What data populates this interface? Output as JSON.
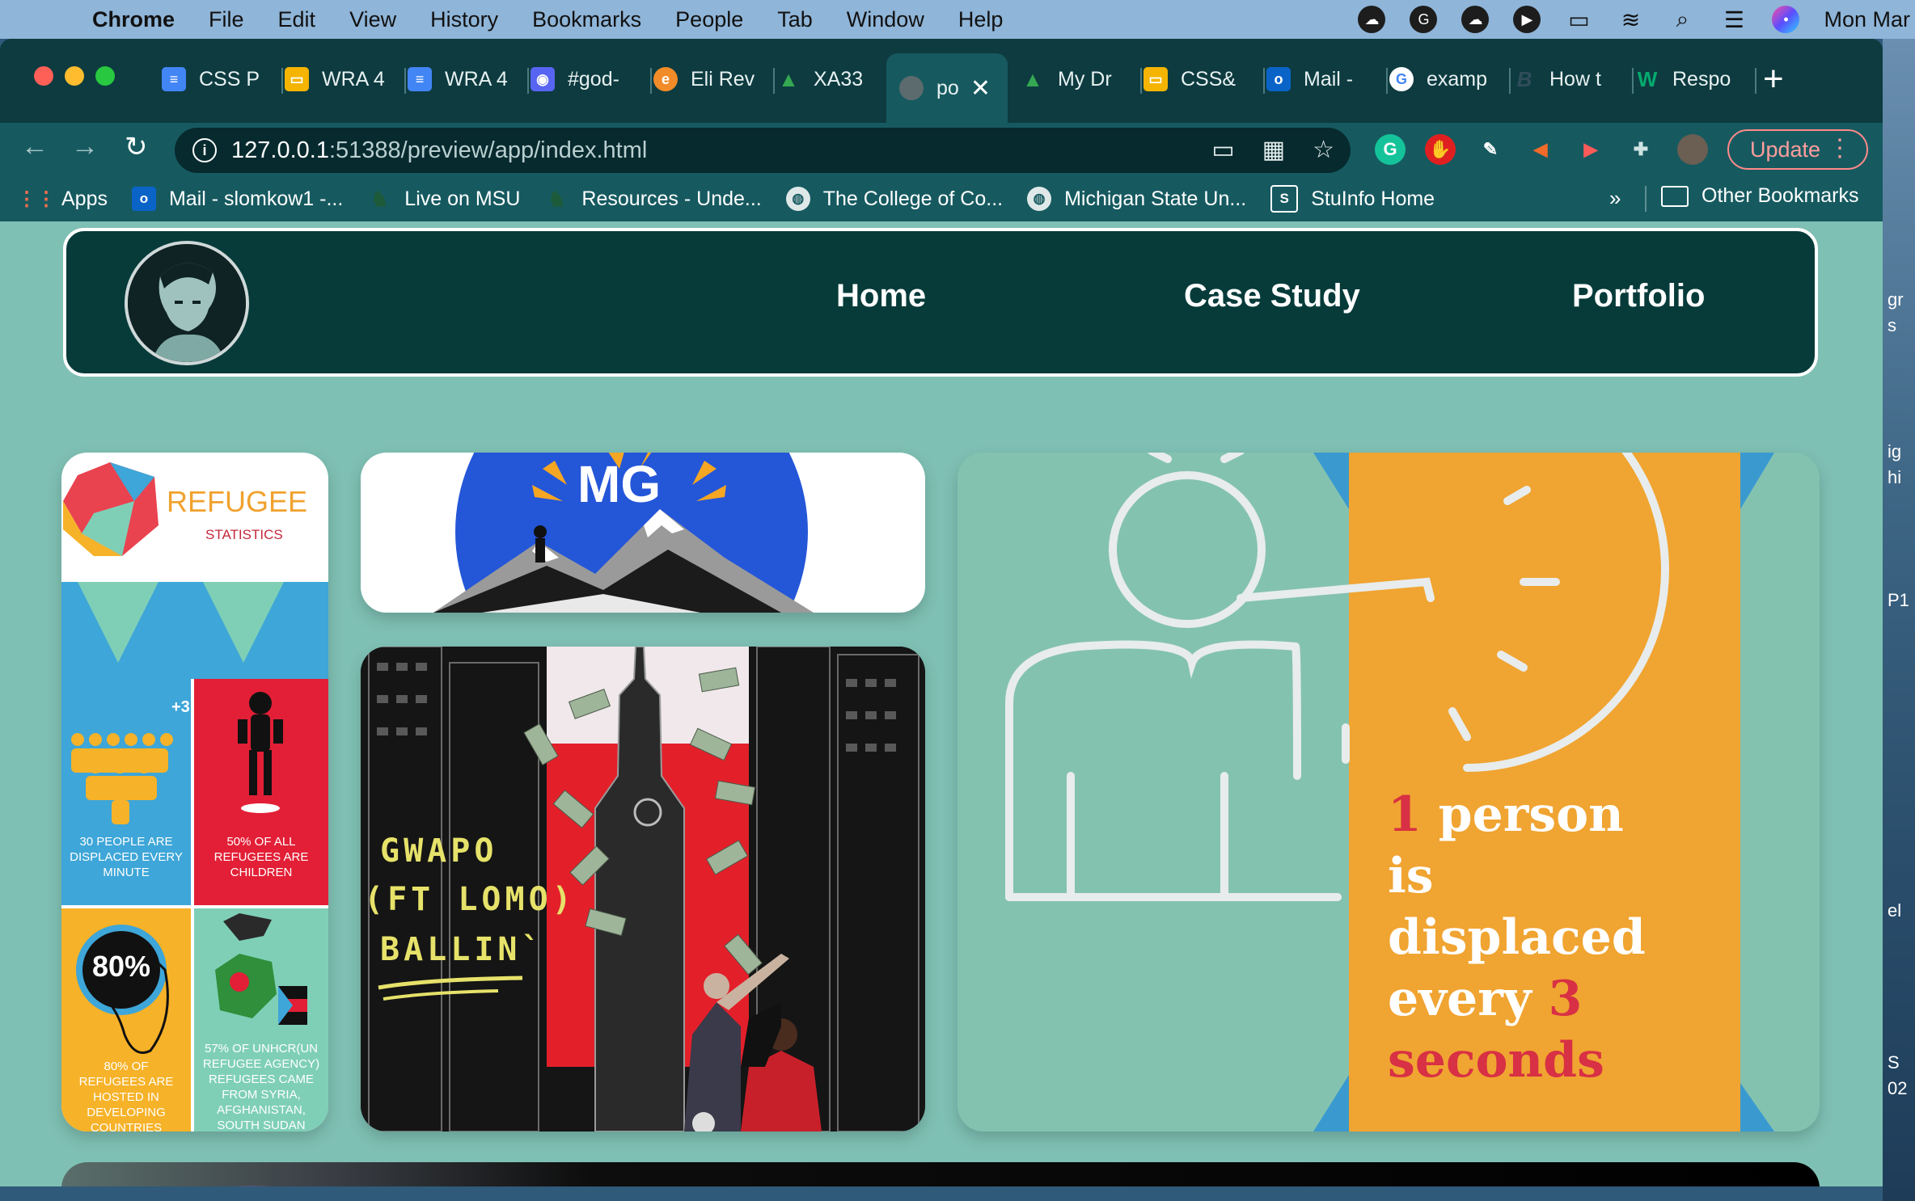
{
  "menubar": {
    "app": "Chrome",
    "items": [
      "File",
      "Edit",
      "View",
      "History",
      "Bookmarks",
      "People",
      "Tab",
      "Window",
      "Help"
    ],
    "clock": "Mon Mar"
  },
  "tabs": [
    {
      "label": "CSS P",
      "icon": "google-docs-icon",
      "color": "#4285f4"
    },
    {
      "label": "WRA 4",
      "icon": "google-slides-icon",
      "color": "#f4b400"
    },
    {
      "label": "WRA 4",
      "icon": "google-docs-icon",
      "color": "#4285f4"
    },
    {
      "label": "#god-",
      "icon": "discord-icon",
      "color": "#5865f2"
    },
    {
      "label": "Eli Rev",
      "icon": "eli-review-icon",
      "color": "#f28c28"
    },
    {
      "label": "XA33",
      "icon": "google-drive-icon",
      "color": "#34a853"
    },
    {
      "label": "po",
      "icon": "globe-icon",
      "color": "#6b7a7c",
      "active": true
    },
    {
      "label": "My Dr",
      "icon": "google-drive-icon",
      "color": "#34a853"
    },
    {
      "label": "CSS&",
      "icon": "google-slides-icon",
      "color": "#f4b400"
    },
    {
      "label": "Mail -",
      "icon": "outlook-icon",
      "color": "#0a64c8"
    },
    {
      "label": "examp",
      "icon": "google-icon",
      "color": "#ffffff"
    },
    {
      "label": "How t",
      "icon": "bootstrap-icon",
      "color": "#2f3d4a"
    },
    {
      "label": "Respo",
      "icon": "w3schools-icon",
      "color": "#04aa6d"
    }
  ],
  "toolbar": {
    "url_host": "127.0.0.1",
    "url_path": ":51388/preview/app/index.html",
    "update_label": "Update"
  },
  "bookmarks": {
    "items": [
      {
        "label": "Apps",
        "icon": "apps-grid-icon"
      },
      {
        "label": "Mail - slomkow1 -...",
        "icon": "outlook-icon"
      },
      {
        "label": "Live on MSU",
        "icon": "spartan-helmet-icon"
      },
      {
        "label": "Resources - Unde...",
        "icon": "spartan-helmet-icon"
      },
      {
        "label": "The College of Co...",
        "icon": "globe-icon"
      },
      {
        "label": "Michigan State Un...",
        "icon": "globe-icon"
      },
      {
        "label": "StuInfo Home",
        "icon": "stuinfo-icon"
      }
    ],
    "more": "»",
    "other": "Other Bookmarks"
  },
  "site": {
    "nav": [
      "Home",
      "Case Study",
      "Portfolio"
    ],
    "infographic": {
      "title": "REFUGEE",
      "subtitle": "STATISTICS",
      "badge": "+3",
      "stat1": "30 PEOPLE ARE DISPLACED EVERY MINUTE",
      "stat2": "50% OF ALL REFUGEES ARE CHILDREN",
      "stat3_big": "80%",
      "stat3": "80% OF REFUGEES ARE HOSTED IN DEVELOPING COUNTRIES",
      "stat4": "57% OF UNHCR(UN REFUGEE AGENCY) REFUGEES CAME FROM SYRIA, AFGHANISTAN, SOUTH SUDAN"
    },
    "mg_logo": "MG",
    "music": {
      "line1": "GWAPO",
      "line2": "(FT LOMO)",
      "line3": "BALLIN`"
    },
    "stat": {
      "num1": "1",
      "part1": " person is displaced every ",
      "num2": "3",
      "part2": "seconds"
    }
  },
  "desktop_fragments": [
    "gr",
    "s",
    "ig",
    "hi",
    "P1",
    "el",
    "S",
    "02"
  ]
}
